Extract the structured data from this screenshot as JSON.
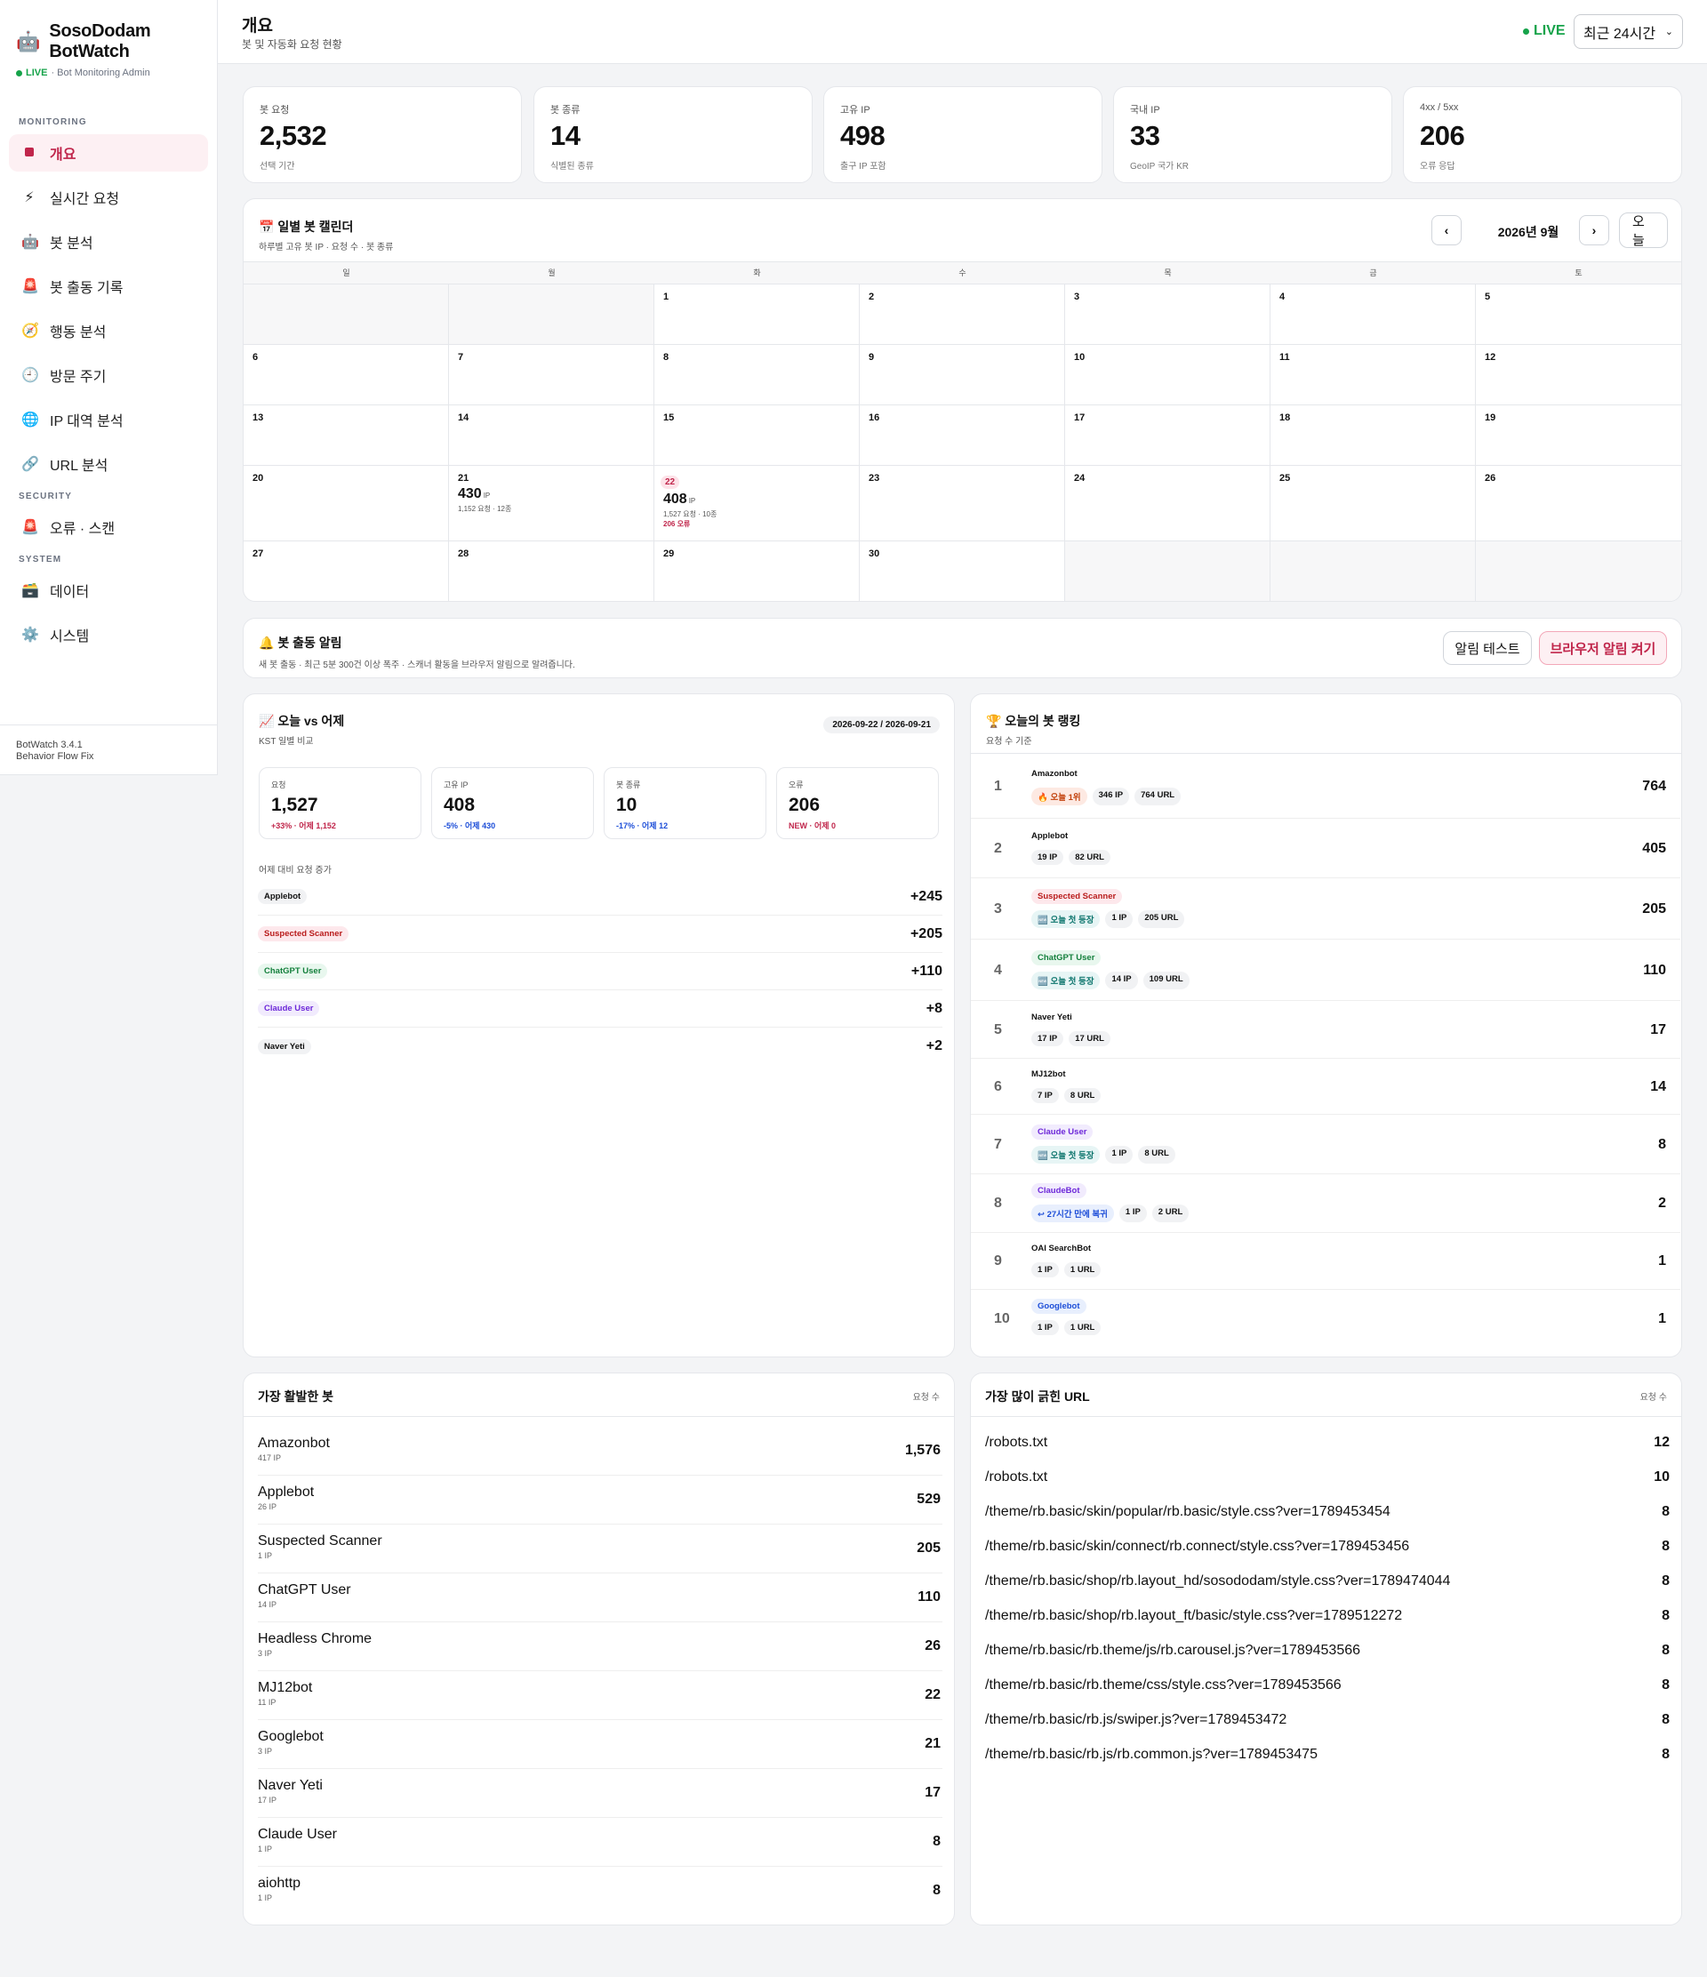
{
  "brand": {
    "icon": "🤖",
    "title": "SosoDodam BotWatch",
    "live": "LIVE",
    "sub": "· Bot Monitoring Admin"
  },
  "sidebar": {
    "sections": [
      {
        "label": "MONITORING",
        "items": [
          {
            "icon": "grid-square-icon",
            "label": "개요",
            "active": true
          },
          {
            "icon": "⚡",
            "label": "실시간 요청"
          },
          {
            "icon": "🤖",
            "label": "봇 분석"
          },
          {
            "icon": "🚨",
            "label": "봇 출동 기록"
          },
          {
            "icon": "🧭",
            "label": "행동 분석"
          },
          {
            "icon": "🕘",
            "label": "방문 주기"
          },
          {
            "icon": "🌐",
            "label": "IP 대역 분석"
          },
          {
            "icon": "🔗",
            "label": "URL 분석"
          }
        ]
      },
      {
        "label": "SECURITY",
        "items": [
          {
            "icon": "🚨",
            "label": "오류 · 스캔"
          }
        ]
      },
      {
        "label": "SYSTEM",
        "items": [
          {
            "icon": "🗃️",
            "label": "데이터"
          },
          {
            "icon": "⚙️",
            "label": "시스템"
          }
        ]
      }
    ],
    "footer_version": "BotWatch 3.4.1",
    "footer_note": "Behavior Flow Fix"
  },
  "header": {
    "title": "개요",
    "subtitle": "봇 및 자동화 요청 현황",
    "live": "LIVE",
    "range": "최근 24시간"
  },
  "kpis": [
    {
      "label": "봇 요청",
      "value": "2,532",
      "sub": "선택 기간"
    },
    {
      "label": "봇 종류",
      "value": "14",
      "sub": "식별된 종류"
    },
    {
      "label": "고유 IP",
      "value": "498",
      "sub": "출구 IP 포함"
    },
    {
      "label": "국내 IP",
      "value": "33",
      "sub": "GeoIP 국가 KR"
    },
    {
      "label": "4xx / 5xx",
      "value": "206",
      "sub": "오류 응답"
    }
  ],
  "calendar": {
    "title": "📅 일별 봇 캘린더",
    "subtitle": "하루별 고유 봇 IP · 요청 수 · 봇 종류",
    "month": "2026년 9월",
    "prev": "‹",
    "next": "›",
    "today_btn": "오늘",
    "weekdays": [
      "일",
      "월",
      "화",
      "수",
      "목",
      "금",
      "토"
    ],
    "cells": [
      {
        "d": ""
      },
      {
        "d": ""
      },
      {
        "d": "1"
      },
      {
        "d": "2"
      },
      {
        "d": "3"
      },
      {
        "d": "4"
      },
      {
        "d": "5"
      },
      {
        "d": "6"
      },
      {
        "d": "7"
      },
      {
        "d": "8"
      },
      {
        "d": "9"
      },
      {
        "d": "10"
      },
      {
        "d": "11"
      },
      {
        "d": "12"
      },
      {
        "d": "13"
      },
      {
        "d": "14"
      },
      {
        "d": "15"
      },
      {
        "d": "16"
      },
      {
        "d": "17"
      },
      {
        "d": "18"
      },
      {
        "d": "19"
      },
      {
        "d": "20"
      },
      {
        "d": "21",
        "ip": "430",
        "meta": "1,152 요청 · 12종"
      },
      {
        "d": "22",
        "today": true,
        "ip": "408",
        "meta": "1,527 요청 · 10종",
        "err": "206 오류"
      },
      {
        "d": "23"
      },
      {
        "d": "24"
      },
      {
        "d": "25"
      },
      {
        "d": "26"
      },
      {
        "d": "27"
      },
      {
        "d": "28"
      },
      {
        "d": "29"
      },
      {
        "d": "30"
      },
      {
        "d": ""
      },
      {
        "d": ""
      },
      {
        "d": ""
      }
    ],
    "ip_unit": "IP"
  },
  "alert": {
    "title": "🔔 봇 출동 알림",
    "subtitle": "새 봇 출동 · 최근 5분 300건 이상 폭주 · 스캐너 활동을 브라우저 알림으로 알려줍니다.",
    "test_btn": "알림 테스트",
    "enable_btn": "브라우저 알림 켜기"
  },
  "compare": {
    "title": "📈 오늘 vs 어제",
    "subtitle": "KST 일별 비교",
    "dates": "2026-09-22 / 2026-09-21",
    "stats": [
      {
        "label": "요청",
        "value": "1,527",
        "delta": "+33% · 어제 1,152",
        "dir": "up"
      },
      {
        "label": "고유 IP",
        "value": "408",
        "delta": "-5% · 어제 430",
        "dir": "down"
      },
      {
        "label": "봇 종류",
        "value": "10",
        "delta": "-17% · 어제 12",
        "dir": "down"
      },
      {
        "label": "오류",
        "value": "206",
        "delta": "NEW · 어제 0",
        "dir": "up"
      }
    ],
    "inc_label": "어제 대비 요청 증가",
    "increases": [
      {
        "name": "Applebot",
        "style": "",
        "value": "+245"
      },
      {
        "name": "Suspected Scanner",
        "style": "red",
        "value": "+205"
      },
      {
        "name": "ChatGPT User",
        "style": "green",
        "value": "+110"
      },
      {
        "name": "Claude User",
        "style": "purple",
        "value": "+8"
      },
      {
        "name": "Naver Yeti",
        "style": "",
        "value": "+2"
      }
    ]
  },
  "ranking": {
    "title": "🏆 오늘의 봇 랭킹",
    "subtitle": "요청 수 기준",
    "rows": [
      {
        "rank": "1",
        "name": "Amazonbot",
        "style": "",
        "tags": [
          {
            "t": "🔥 오늘 1위",
            "s": "orange"
          },
          {
            "t": "346 IP",
            "s": ""
          },
          {
            "t": "764 URL",
            "s": ""
          }
        ],
        "value": "764"
      },
      {
        "rank": "2",
        "name": "Applebot",
        "style": "",
        "tags": [
          {
            "t": "19 IP",
            "s": ""
          },
          {
            "t": "82 URL",
            "s": ""
          }
        ],
        "value": "405"
      },
      {
        "rank": "3",
        "name": "Suspected Scanner",
        "style": "red",
        "tags": [
          {
            "t": "🆕 오늘 첫 등장",
            "s": "teal"
          },
          {
            "t": "1 IP",
            "s": ""
          },
          {
            "t": "205 URL",
            "s": ""
          }
        ],
        "value": "205"
      },
      {
        "rank": "4",
        "name": "ChatGPT User",
        "style": "green",
        "tags": [
          {
            "t": "🆕 오늘 첫 등장",
            "s": "teal"
          },
          {
            "t": "14 IP",
            "s": ""
          },
          {
            "t": "109 URL",
            "s": ""
          }
        ],
        "value": "110"
      },
      {
        "rank": "5",
        "name": "Naver Yeti",
        "style": "",
        "tags": [
          {
            "t": "17 IP",
            "s": ""
          },
          {
            "t": "17 URL",
            "s": ""
          }
        ],
        "value": "17"
      },
      {
        "rank": "6",
        "name": "MJ12bot",
        "style": "",
        "tags": [
          {
            "t": "7 IP",
            "s": ""
          },
          {
            "t": "8 URL",
            "s": ""
          }
        ],
        "value": "14"
      },
      {
        "rank": "7",
        "name": "Claude User",
        "style": "purple",
        "tags": [
          {
            "t": "🆕 오늘 첫 등장",
            "s": "teal"
          },
          {
            "t": "1 IP",
            "s": ""
          },
          {
            "t": "8 URL",
            "s": ""
          }
        ],
        "value": "8"
      },
      {
        "rank": "8",
        "name": "ClaudeBot",
        "style": "purple",
        "tags": [
          {
            "t": "↩ 27시간 만에 복귀",
            "s": "blue"
          },
          {
            "t": "1 IP",
            "s": ""
          },
          {
            "t": "2 URL",
            "s": ""
          }
        ],
        "value": "2"
      },
      {
        "rank": "9",
        "name": "OAI SearchBot",
        "style": "",
        "tags": [
          {
            "t": "1 IP",
            "s": ""
          },
          {
            "t": "1 URL",
            "s": ""
          }
        ],
        "value": "1"
      },
      {
        "rank": "10",
        "name": "Googlebot",
        "style": "blue",
        "tags": [
          {
            "t": "1 IP",
            "s": ""
          },
          {
            "t": "1 URL",
            "s": ""
          }
        ],
        "value": "1"
      }
    ]
  },
  "active_bots": {
    "title": "가장 활발한 봇",
    "right": "요청 수",
    "rows": [
      {
        "name": "Amazonbot",
        "sub": "417 IP",
        "value": "1,576"
      },
      {
        "name": "Applebot",
        "sub": "26 IP",
        "value": "529"
      },
      {
        "name": "Suspected Scanner",
        "sub": "1 IP",
        "value": "205"
      },
      {
        "name": "ChatGPT User",
        "sub": "14 IP",
        "value": "110"
      },
      {
        "name": "Headless Chrome",
        "sub": "3 IP",
        "value": "26"
      },
      {
        "name": "MJ12bot",
        "sub": "11 IP",
        "value": "22"
      },
      {
        "name": "Googlebot",
        "sub": "3 IP",
        "value": "21"
      },
      {
        "name": "Naver Yeti",
        "sub": "17 IP",
        "value": "17"
      },
      {
        "name": "Claude User",
        "sub": "1 IP",
        "value": "8"
      },
      {
        "name": "aiohttp",
        "sub": "1 IP",
        "value": "8"
      }
    ]
  },
  "top_urls": {
    "title": "가장 많이 긁힌 URL",
    "right": "요청 수",
    "rows": [
      {
        "url": "/robots.txt",
        "value": "12"
      },
      {
        "url": "/robots.txt",
        "value": "10"
      },
      {
        "url": "/theme/rb.basic/skin/popular/rb.basic/style.css?ver=1789453454",
        "value": "8"
      },
      {
        "url": "/theme/rb.basic/skin/connect/rb.connect/style.css?ver=1789453456",
        "value": "8"
      },
      {
        "url": "/theme/rb.basic/shop/rb.layout_hd/sosododam/style.css?ver=1789474044",
        "value": "8"
      },
      {
        "url": "/theme/rb.basic/shop/rb.layout_ft/basic/style.css?ver=1789512272",
        "value": "8"
      },
      {
        "url": "/theme/rb.basic/rb.theme/js/rb.carousel.js?ver=1789453566",
        "value": "8"
      },
      {
        "url": "/theme/rb.basic/rb.theme/css/style.css?ver=1789453566",
        "value": "8"
      },
      {
        "url": "/theme/rb.basic/rb.js/swiper.js?ver=1789453472",
        "value": "8"
      },
      {
        "url": "/theme/rb.basic/rb.js/rb.common.js?ver=1789453475",
        "value": "8"
      }
    ]
  }
}
